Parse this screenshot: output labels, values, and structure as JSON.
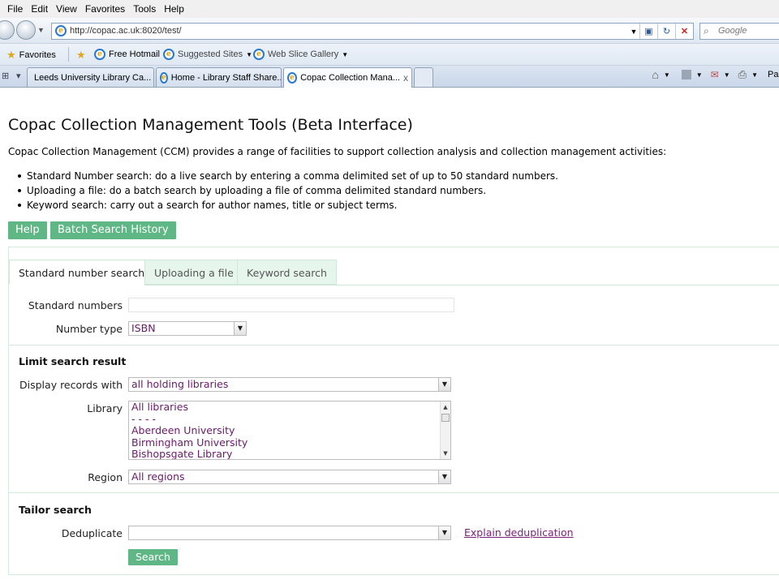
{
  "browser": {
    "menu": [
      "File",
      "Edit",
      "View",
      "Favorites",
      "Tools",
      "Help"
    ],
    "address_url": "http://copac.ac.uk:8020/test/",
    "search_placeholder": "Google",
    "favorites_bar": {
      "favorites_label": "Favorites",
      "items": [
        "Free Hotmail",
        "Suggested Sites",
        "Web Slice Gallery"
      ]
    },
    "tabs": [
      {
        "label": "Leeds University Library Ca..."
      },
      {
        "label": "Home - Library Staff Share..."
      },
      {
        "label": "Copac Collection Mana..."
      }
    ],
    "tab_close": "x",
    "command_page_label": "Pag"
  },
  "page": {
    "title": "Copac Collection Management Tools (Beta Interface)",
    "intro": "Copac Collection Management (CCM) provides a range of facilities to support collection analysis and collection management activities:",
    "bullets": [
      "Standard Number search: do a live search by entering a comma delimited set of up to 50 standard numbers.",
      "Uploading a file: do a batch search by uploading a file of comma delimited standard numbers.",
      "Keyword search: carry out a search for author names, title or subject terms."
    ],
    "buttons": {
      "help": "Help",
      "history": "Batch Search History"
    },
    "tabs": [
      "Standard number search",
      "Uploading a file",
      "Keyword search"
    ],
    "form": {
      "standard_numbers_label": "Standard numbers",
      "standard_numbers_value": "",
      "number_type_label": "Number type",
      "number_type_value": "ISBN",
      "limit_heading": "Limit search result",
      "display_label": "Display records with",
      "display_value": "all holding libraries",
      "library_label": "Library",
      "library_options": [
        "All libraries",
        "- - - -",
        "Aberdeen University",
        "Birmingham University",
        "Bishopsgate Library"
      ],
      "region_label": "Region",
      "region_value": "All regions",
      "tailor_heading": "Tailor search",
      "dedup_label": "Deduplicate",
      "dedup_value": "",
      "dedup_link": "Explain deduplication",
      "search_button": "Search"
    }
  }
}
